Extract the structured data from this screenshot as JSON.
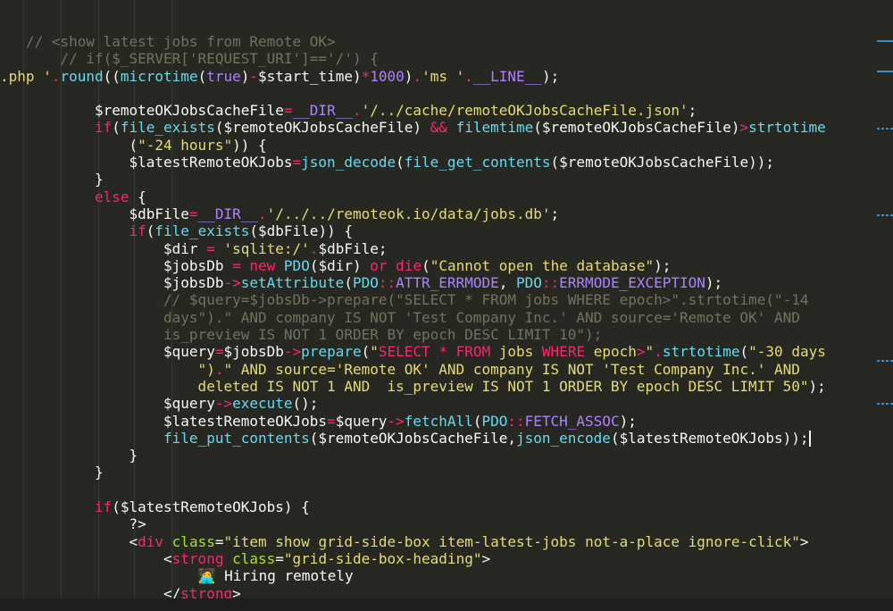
{
  "colors": {
    "background": "#272822",
    "plain": "#f8f8f2",
    "comment": "#75715e",
    "keyword": "#f92672",
    "function": "#66d9ef",
    "string": "#e6db74",
    "constant": "#ae81ff",
    "attribute": "#a6e22e",
    "minimap": "#3a8ec9"
  },
  "editor": {
    "lines": [
      [
        [
          "comment",
          "   // <show latest jobs from Remote OK>"
        ]
      ],
      [
        [
          "comment",
          "       // if($_SERVER['REQUEST_URI']=='/') {"
        ]
      ],
      [
        [
          "string",
          ".php '"
        ],
        [
          "keyword",
          "."
        ],
        [
          "function",
          "round"
        ],
        [
          "plain",
          "(("
        ],
        [
          "function",
          "microtime"
        ],
        [
          "plain",
          "("
        ],
        [
          "constant",
          "true"
        ],
        [
          "plain",
          ")"
        ],
        [
          "keyword",
          "-"
        ],
        [
          "plain",
          "$start_time)"
        ],
        [
          "keyword",
          "*"
        ],
        [
          "constant",
          "1000"
        ],
        [
          "plain",
          ")"
        ],
        [
          "keyword",
          "."
        ],
        [
          "string",
          "'ms '"
        ],
        [
          "keyword",
          "."
        ],
        [
          "constant",
          "__LINE__"
        ],
        [
          "plain",
          ");"
        ]
      ],
      [
        [
          "plain",
          ""
        ]
      ],
      [
        [
          "plain",
          "           $remoteOKJobsCacheFile"
        ],
        [
          "keyword",
          "="
        ],
        [
          "constant",
          "__DIR__"
        ],
        [
          "keyword",
          "."
        ],
        [
          "string",
          "'/../cache/remoteOKJobsCacheFile.json'"
        ],
        [
          "plain",
          ";"
        ]
      ],
      [
        [
          "keyword",
          "           if"
        ],
        [
          "plain",
          "("
        ],
        [
          "function",
          "file_exists"
        ],
        [
          "plain",
          "($remoteOKJobsCacheFile) "
        ],
        [
          "keyword",
          "&&"
        ],
        [
          "plain",
          " "
        ],
        [
          "function",
          "filemtime"
        ],
        [
          "plain",
          "($remoteOKJobsCacheFile)"
        ],
        [
          "keyword",
          ">"
        ],
        [
          "function",
          "strtotime"
        ]
      ],
      [
        [
          "plain",
          "               ("
        ],
        [
          "string",
          "\"-24 hours\""
        ],
        [
          "plain",
          ")) {"
        ]
      ],
      [
        [
          "plain",
          "               $latestRemoteOKJobs"
        ],
        [
          "keyword",
          "="
        ],
        [
          "function",
          "json_decode"
        ],
        [
          "plain",
          "("
        ],
        [
          "function",
          "file_get_contents"
        ],
        [
          "plain",
          "($remoteOKJobsCacheFile));"
        ]
      ],
      [
        [
          "plain",
          "           }"
        ]
      ],
      [
        [
          "keyword",
          "           else"
        ],
        [
          "plain",
          " {"
        ]
      ],
      [
        [
          "plain",
          "               $dbFile"
        ],
        [
          "keyword",
          "="
        ],
        [
          "constant",
          "__DIR__"
        ],
        [
          "keyword",
          "."
        ],
        [
          "string",
          "'/../../remoteok.io/data/jobs.db'"
        ],
        [
          "plain",
          ";"
        ]
      ],
      [
        [
          "keyword",
          "               if"
        ],
        [
          "plain",
          "("
        ],
        [
          "function",
          "file_exists"
        ],
        [
          "plain",
          "($dbFile)) {"
        ]
      ],
      [
        [
          "plain",
          "                   $dir "
        ],
        [
          "keyword",
          "="
        ],
        [
          "plain",
          " "
        ],
        [
          "string",
          "'sqlite:/'"
        ],
        [
          "keyword",
          "."
        ],
        [
          "plain",
          "$dbFile;"
        ]
      ],
      [
        [
          "plain",
          "                   $jobsDb "
        ],
        [
          "keyword",
          "="
        ],
        [
          "plain",
          " "
        ],
        [
          "keyword",
          "new"
        ],
        [
          "plain",
          " "
        ],
        [
          "function",
          "PDO"
        ],
        [
          "plain",
          "($dir) "
        ],
        [
          "keyword",
          "or"
        ],
        [
          "plain",
          " "
        ],
        [
          "keyword",
          "die"
        ],
        [
          "plain",
          "("
        ],
        [
          "string",
          "\"Cannot open the database\""
        ],
        [
          "plain",
          ");"
        ]
      ],
      [
        [
          "plain",
          "                   $jobsDb"
        ],
        [
          "keyword",
          "->"
        ],
        [
          "function",
          "setAttribute"
        ],
        [
          "plain",
          "("
        ],
        [
          "function",
          "PDO"
        ],
        [
          "keyword",
          "::"
        ],
        [
          "constant",
          "ATTR_ERRMODE"
        ],
        [
          "plain",
          ", "
        ],
        [
          "function",
          "PDO"
        ],
        [
          "keyword",
          "::"
        ],
        [
          "constant",
          "ERRMODE_EXCEPTION"
        ],
        [
          "plain",
          ");"
        ]
      ],
      [
        [
          "comment",
          "                   // $query=$jobsDb->prepare(\"SELECT * FROM jobs WHERE epoch>\".strtotime(\"-14"
        ]
      ],
      [
        [
          "comment",
          "                   days\").\" AND company IS NOT 'Test Company Inc.' AND source='Remote OK' AND"
        ]
      ],
      [
        [
          "comment",
          "                   is_preview IS NOT 1 ORDER BY epoch DESC LIMIT 10\");"
        ]
      ],
      [
        [
          "plain",
          "                   $query"
        ],
        [
          "keyword",
          "="
        ],
        [
          "plain",
          "$jobsDb"
        ],
        [
          "keyword",
          "->"
        ],
        [
          "function",
          "prepare"
        ],
        [
          "plain",
          "("
        ],
        [
          "string",
          "\""
        ],
        [
          "keyword",
          "SELECT * FROM"
        ],
        [
          "string",
          " jobs "
        ],
        [
          "keyword",
          "WHERE"
        ],
        [
          "string",
          " epoch"
        ],
        [
          "keyword",
          ">"
        ],
        [
          "string",
          "\""
        ],
        [
          "keyword",
          "."
        ],
        [
          "function",
          "strtotime"
        ],
        [
          "plain",
          "("
        ],
        [
          "string",
          "\"-30 days"
        ]
      ],
      [
        [
          "string",
          "                       \")"
        ],
        [
          "keyword",
          "."
        ],
        [
          "string",
          "\" AND source='Remote OK' AND company IS NOT 'Test Company Inc.' AND"
        ]
      ],
      [
        [
          "string",
          "                       deleted IS NOT 1 AND  is_preview IS NOT 1 ORDER BY epoch DESC LIMIT 50\""
        ],
        [
          "plain",
          ");"
        ]
      ],
      [
        [
          "plain",
          "                   $query"
        ],
        [
          "keyword",
          "->"
        ],
        [
          "function",
          "execute"
        ],
        [
          "plain",
          "();"
        ]
      ],
      [
        [
          "plain",
          "                   $latestRemoteOKJobs"
        ],
        [
          "keyword",
          "="
        ],
        [
          "plain",
          "$query"
        ],
        [
          "keyword",
          "->"
        ],
        [
          "function",
          "fetchAll"
        ],
        [
          "plain",
          "("
        ],
        [
          "function",
          "PDO"
        ],
        [
          "keyword",
          "::"
        ],
        [
          "constant",
          "FETCH_ASSOC"
        ],
        [
          "plain",
          ");"
        ]
      ],
      [
        [
          "function",
          "                   file_put_contents"
        ],
        [
          "plain",
          "($remoteOKJobsCacheFile,"
        ],
        [
          "function",
          "json_encode"
        ],
        [
          "plain",
          "($latestRemoteOKJobs));"
        ]
      ],
      [
        [
          "plain",
          "               }"
        ]
      ],
      [
        [
          "plain",
          "           }"
        ]
      ],
      [
        [
          "plain",
          ""
        ]
      ],
      [
        [
          "keyword",
          "           if"
        ],
        [
          "plain",
          "($latestRemoteOKJobs) {"
        ]
      ],
      [
        [
          "plain",
          "               ?>"
        ]
      ],
      [
        [
          "plain",
          "               <"
        ],
        [
          "keyword",
          "div"
        ],
        [
          "plain",
          " "
        ],
        [
          "attribute",
          "class"
        ],
        [
          "plain",
          "="
        ],
        [
          "string",
          "\"item show grid-side-box item-latest-jobs not-a-place ignore-click\""
        ],
        [
          "plain",
          ">"
        ]
      ],
      [
        [
          "plain",
          "                   <"
        ],
        [
          "keyword",
          "strong"
        ],
        [
          "plain",
          " "
        ],
        [
          "attribute",
          "class"
        ],
        [
          "plain",
          "="
        ],
        [
          "string",
          "\"grid-side-box-heading\""
        ],
        [
          "plain",
          ">"
        ]
      ],
      [
        [
          "plain",
          "                       🧑‍💻 Hiring remotely"
        ]
      ],
      [
        [
          "plain",
          "                   </"
        ],
        [
          "keyword",
          "strong"
        ],
        [
          "plain",
          ">"
        ]
      ]
    ]
  }
}
